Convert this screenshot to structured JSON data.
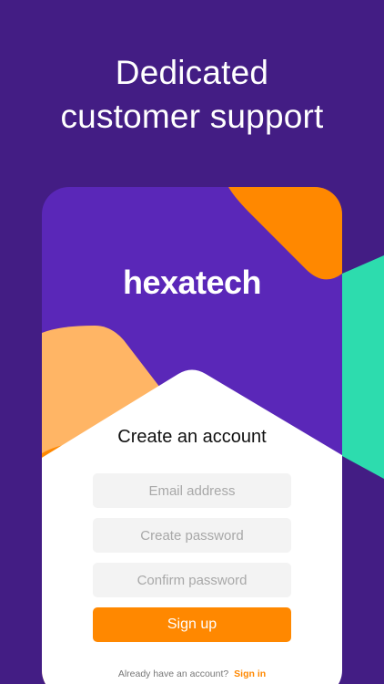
{
  "screen": {
    "headline_line1": "Dedicated",
    "headline_line2": "customer support"
  },
  "app": {
    "logo_text": "hexatech"
  },
  "signup_form": {
    "title": "Create an account",
    "email_placeholder": "Email address",
    "password_placeholder": "Create password",
    "confirm_placeholder": "Confirm password",
    "submit_label": "Sign up"
  },
  "footer": {
    "prompt": "Already have an account?",
    "signin_label": "Sign in"
  },
  "colors": {
    "background": "#431D84",
    "card_purple": "#5A27B8",
    "orange": "#FF8800",
    "peach": "#FFB565",
    "teal": "#2DDCAE",
    "white": "#FFFFFF"
  }
}
